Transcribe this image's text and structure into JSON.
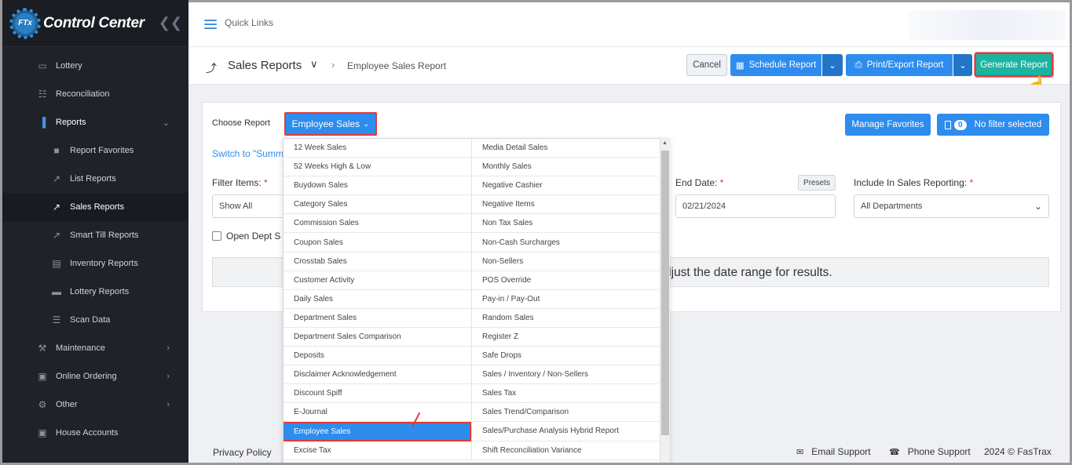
{
  "brand": {
    "logo_text": "FTx",
    "name": "Control Center"
  },
  "sidebar": {
    "items": [
      {
        "label": "Lottery",
        "icon": "ticket-icon"
      },
      {
        "label": "Reconciliation",
        "icon": "grid-icon"
      },
      {
        "label": "Reports",
        "icon": "bar-chart-icon"
      },
      {
        "label": "Report Favorites",
        "icon": "bookmark-icon"
      },
      {
        "label": "List Reports",
        "icon": "line-chart-icon"
      },
      {
        "label": "Sales Reports",
        "icon": "line-chart-icon"
      },
      {
        "label": "Smart Till Reports",
        "icon": "line-chart-icon"
      },
      {
        "label": "Inventory Reports",
        "icon": "warehouse-icon"
      },
      {
        "label": "Lottery Reports",
        "icon": "ticket-icon"
      },
      {
        "label": "Scan Data",
        "icon": "list-icon"
      },
      {
        "label": "Maintenance",
        "icon": "wrench-icon"
      },
      {
        "label": "Online Ordering",
        "icon": "bag-icon"
      },
      {
        "label": "Other",
        "icon": "gears-icon"
      },
      {
        "label": "House Accounts",
        "icon": "bag-icon"
      }
    ]
  },
  "topbar": {
    "quick_links": "Quick Links"
  },
  "header": {
    "title": "Sales Reports",
    "breadcrumb": "Employee Sales Report",
    "cancel": "Cancel",
    "schedule": "Schedule Report",
    "print": "Print/Export Report",
    "generate": "Generate Report"
  },
  "form": {
    "choose_label": "Choose Report",
    "choose_value": "Employee Sales",
    "manage_favorites": "Manage Favorites",
    "filter_count": "0",
    "filter_text": "No filter selected",
    "switch_link": "Switch to \"Summ",
    "filter_items_label": "Filter Items:",
    "filter_items_value": "Show All",
    "end_date_label": "End Date:",
    "presets": "Presets",
    "end_date_value": "02/21/2024",
    "include_label": "Include In Sales Reporting:",
    "include_value": "All Departments",
    "open_dept_label": "Open Dept Sa",
    "notice": "djust the date range for results.",
    "required_mark": "*"
  },
  "menu": {
    "left": [
      "12 Week Sales",
      "52 Weeks High & Low",
      "Buydown Sales",
      "Category Sales",
      "Commission Sales",
      "Coupon Sales",
      "Crosstab Sales",
      "Customer Activity",
      "Daily Sales",
      "Department Sales",
      "Department Sales Comparison",
      "Deposits",
      "Disclaimer Acknowledgement",
      "Discount Spiff",
      "E-Journal",
      "Employee Sales",
      "Excise Tax"
    ],
    "right": [
      "Media Detail Sales",
      "Monthly Sales",
      "Negative Cashier",
      "Negative Items",
      "Non Tax Sales",
      "Non-Cash Surcharges",
      "Non-Sellers",
      "POS Override",
      "Pay-in / Pay-Out",
      "Random Sales",
      "Register Z",
      "Safe Drops",
      "Sales / Inventory / Non-Sellers",
      "Sales Tax",
      "Sales Trend/Comparison",
      "Sales/Purchase Analysis Hybrid Report",
      "Shift Reconciliation Variance"
    ],
    "selected": "Employee Sales"
  },
  "footer": {
    "privacy": "Privacy Policy",
    "email": "Email Support",
    "phone": "Phone Support",
    "copyright": "2024 © FasTrax"
  },
  "colors": {
    "primary": "#2d8ced",
    "generate": "#1bb4a0",
    "sidebar": "#1f2229",
    "highlight": "#e03a3a"
  }
}
